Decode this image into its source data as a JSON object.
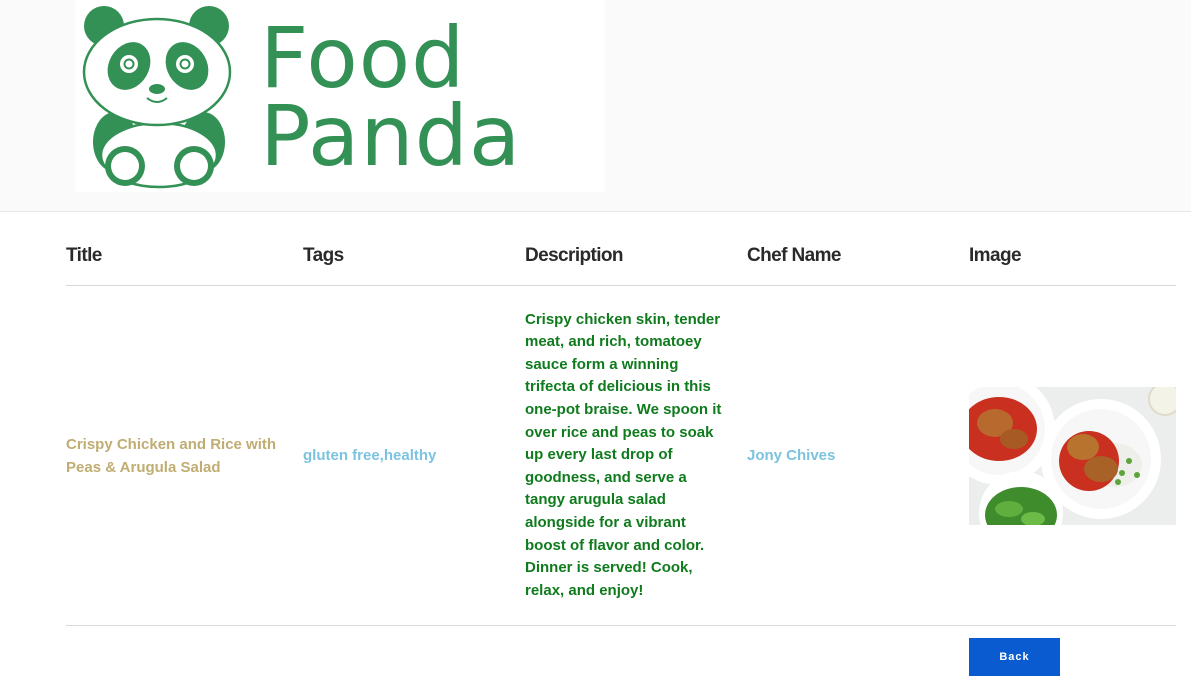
{
  "brand": {
    "line1": "Food",
    "line2": "Panda",
    "color": "#339156"
  },
  "table": {
    "headers": [
      "Title",
      "Tags",
      "Description",
      "Chef Name",
      "Image"
    ],
    "rows": [
      {
        "title": "Crispy Chicken and Rice with Peas & Arugula Salad",
        "tags": "gluten free,healthy",
        "description": "Crispy chicken skin, tender meat, and rich, tomatoey sauce form a winning trifecta of delicious in this one-pot braise. We spoon it over rice and peas to soak up every last drop of goodness, and serve a tangy arugula salad alongside for a vibrant boost of flavor and color. Dinner is served! Cook, relax, and enjoy!",
        "chef": "Jony Chives",
        "image_icon": "food-photo"
      }
    ]
  },
  "actions": {
    "back_label": "Back"
  },
  "colors": {
    "title": "#c0ad72",
    "tags": "#7cc3e0",
    "description": "#0f7b1d",
    "chef": "#7cc3e0",
    "button": "#0a5ad0"
  }
}
